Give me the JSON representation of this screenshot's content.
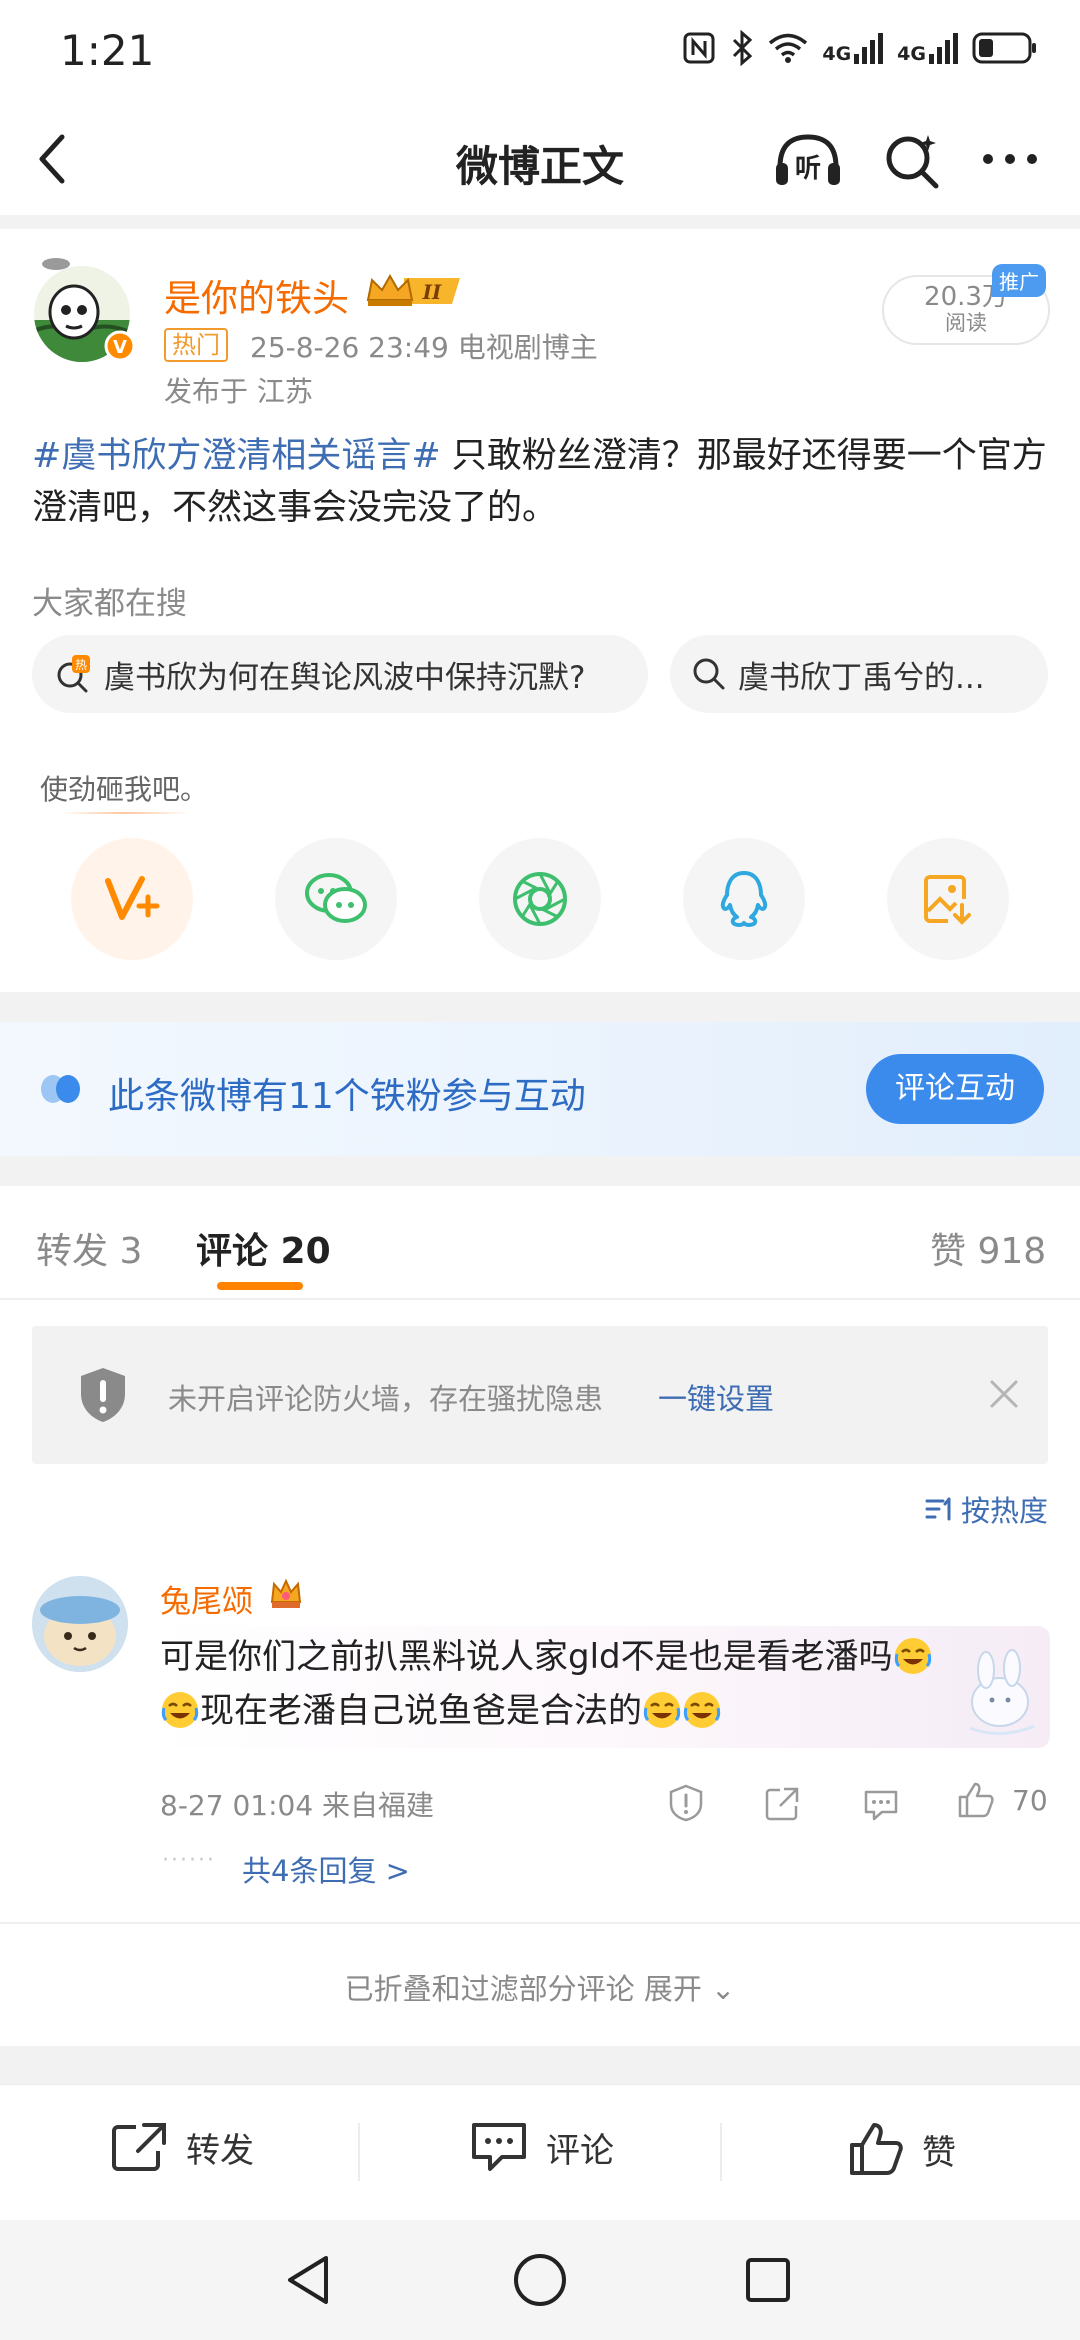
{
  "status_bar": {
    "time": "1:21",
    "signal1": "4G",
    "signal2": "4G"
  },
  "nav": {
    "title": "微博正文",
    "listen_label": "听"
  },
  "post": {
    "author": "是你的铁头",
    "level_badge": "II",
    "hot_tag": "热门",
    "meta": "25-8-26 23:49  电视剧博主",
    "location": "发布于 江苏",
    "read_count": "20.3万",
    "read_label": "阅读",
    "ad_tag": "推广",
    "topic": "#虞书欣方澄清相关谣言#",
    "body": " 只敢粉丝澄清？那最好还得要一个官方澄清吧，不然这事会没完没了的。"
  },
  "search_section": {
    "label": "大家都在搜",
    "chips": [
      {
        "text": "虞书欣为何在舆论风波中保持沉默?",
        "hot_badge": "热"
      },
      {
        "text": "虞书欣丁禹兮的..."
      }
    ]
  },
  "share": {
    "hint": "使劲砸我吧。",
    "buttons": [
      "weibo-v",
      "wechat",
      "moments",
      "qq",
      "save-image"
    ]
  },
  "fans_banner": {
    "text": "此条微博有11个铁粉参与互动",
    "button": "评论互动"
  },
  "tabs": {
    "repost": "转发 3",
    "comment": "评论 20",
    "like": "赞 918"
  },
  "firewall": {
    "text": "未开启评论防火墙，存在骚扰隐患",
    "link": "一键设置"
  },
  "sort": {
    "label": "按热度"
  },
  "comment": {
    "user": "兔尾颂",
    "text_line1": "可是你们之前扒黑料说人家gld不是也是看老潘吗",
    "text_line2": "现在老潘自己说鱼爸是合法的",
    "meta": "8-27 01:04  来自福建",
    "likes": "70",
    "replies": "共4条回复 >"
  },
  "collapsed": {
    "text": "已折叠和过滤部分评论 展开 ⌄"
  },
  "bottom_bar": {
    "repost": "转发",
    "comment": "评论",
    "like": "赞"
  },
  "colors": {
    "accent_orange": "#ff8200",
    "username_orange": "#f56b00",
    "link_blue": "#3f6db3",
    "button_blue": "#3b8bec"
  }
}
